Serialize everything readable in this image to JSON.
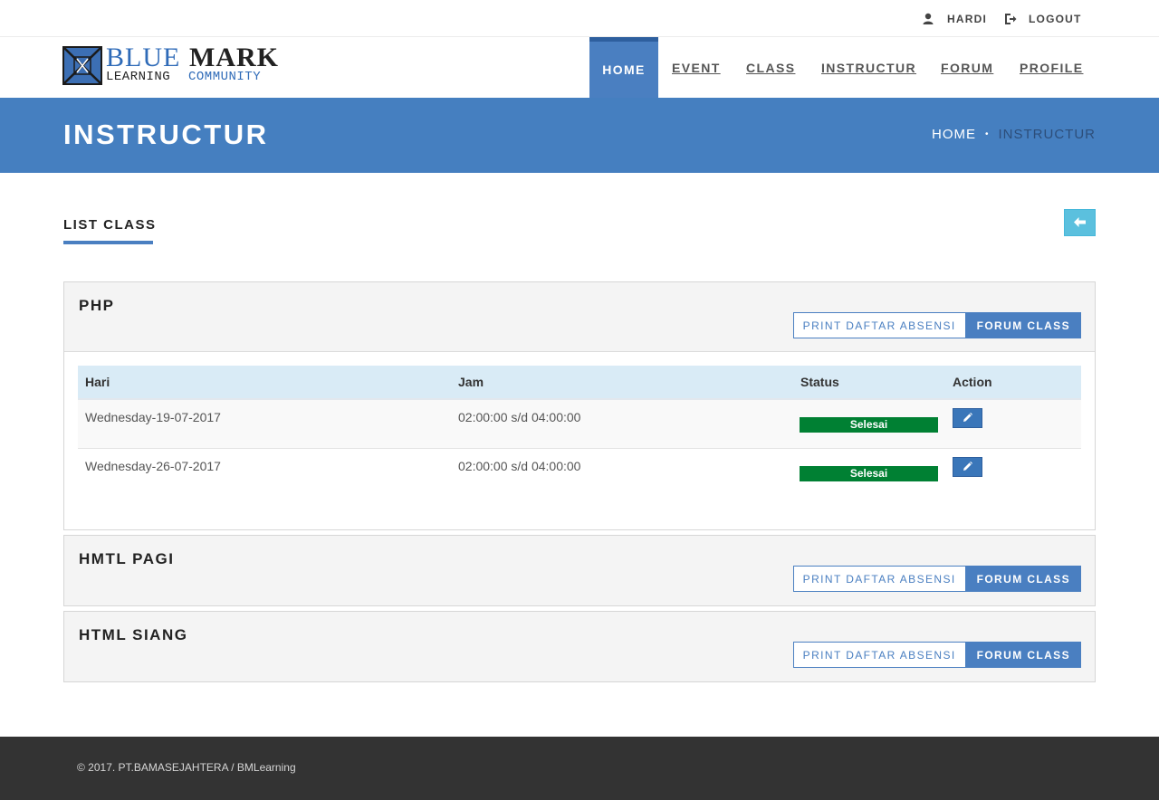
{
  "topbar": {
    "user_label": "HARDI",
    "logout_label": "LOGOUT"
  },
  "logo": {
    "word1": "BLUE",
    "word2": "MARK",
    "word3": "LEARNING",
    "word4": "COMMUNITY"
  },
  "nav": {
    "items": [
      {
        "label": "HOME",
        "active": true
      },
      {
        "label": "EVENT",
        "active": false
      },
      {
        "label": "CLASS",
        "active": false
      },
      {
        "label": "INSTRUCTUR",
        "active": false
      },
      {
        "label": "FORUM",
        "active": false
      },
      {
        "label": "PROFILE",
        "active": false
      }
    ]
  },
  "page_header": {
    "title": "INSTRUCTUR",
    "breadcrumb_home": "HOME",
    "breadcrumb_separator": "•",
    "breadcrumb_current": "INSTRUCTUR"
  },
  "main": {
    "section_title": "LIST CLASS",
    "back_icon": "arrow-left-icon",
    "classes": [
      {
        "name": "PHP",
        "print_label": "PRINT DAFTAR ABSENSI",
        "forum_label": "FORUM CLASS",
        "table": {
          "headers": [
            "Hari",
            "Jam",
            "Status",
            "Action"
          ],
          "rows": [
            {
              "hari": "Wednesday-19-07-2017",
              "jam": "02:00:00 s/d 04:00:00",
              "status": "Selesai"
            },
            {
              "hari": "Wednesday-26-07-2017",
              "jam": "02:00:00 s/d 04:00:00",
              "status": "Selesai"
            }
          ]
        }
      },
      {
        "name": "HMTL PAGI",
        "print_label": "PRINT DAFTAR ABSENSI",
        "forum_label": "FORUM CLASS"
      },
      {
        "name": "HTML SIANG",
        "print_label": "PRINT DAFTAR ABSENSI",
        "forum_label": "FORUM CLASS"
      }
    ]
  },
  "footer": {
    "copyright": "© 2017. PT.BAMASEJAHTERA / BMLearning"
  },
  "colors": {
    "primary": "#457fc0",
    "status_done": "#008033",
    "back_button": "#5bc0de",
    "footer_bg": "#333333"
  }
}
